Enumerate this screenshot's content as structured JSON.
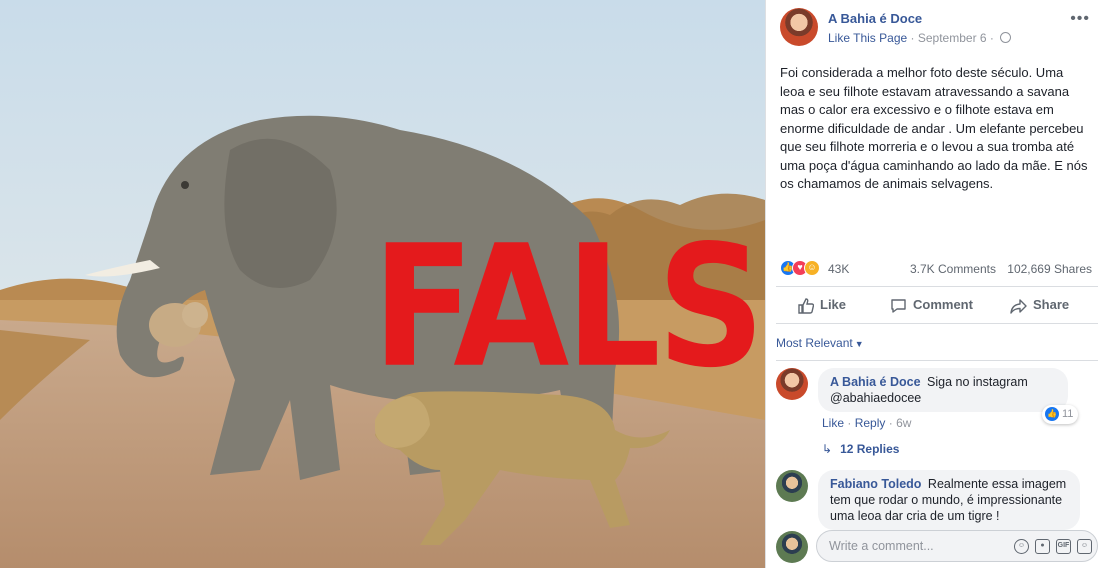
{
  "photo": {
    "stamp_text": "FALSO"
  },
  "post": {
    "page_name": "A Bahia é Doce",
    "like_page": "Like This Page",
    "date": "September 6",
    "separator": "·",
    "more_icon": "ellipsis-icon",
    "text": "Foi considerada a melhor foto deste século. Uma leoa e seu filhote estavam atravessando a savana mas o calor era excessivo e o filhote estava em enorme dificuldade de andar . Um elefante percebeu que seu filhote morreria e o levou a sua tromba até uma poça d'água caminhando ao lado da mãe. E nós os chamamos de animais selvagens."
  },
  "stats": {
    "reactions": "43K",
    "comments": "3.7K Comments",
    "shares": "102,669 Shares"
  },
  "actions": {
    "like": "Like",
    "comment": "Comment",
    "share": "Share"
  },
  "sort": {
    "label": "Most Relevant"
  },
  "comments": [
    {
      "author": "A Bahia é Doce",
      "text": "Siga no instagram @abahiaedocee",
      "like": "Like",
      "reply": "Reply",
      "time": "6w",
      "reaction_count": "11",
      "replies": "12 Replies"
    },
    {
      "author": "Fabiano Toledo",
      "text": "Realmente essa imagem tem que rodar o mundo, é impressionante uma leoa dar cria de um tigre !"
    }
  ],
  "compose": {
    "placeholder": "Write a comment..."
  },
  "colors": {
    "link": "#385898",
    "like_blue": "#1877f2",
    "stamp_red": "#e41a1c"
  }
}
